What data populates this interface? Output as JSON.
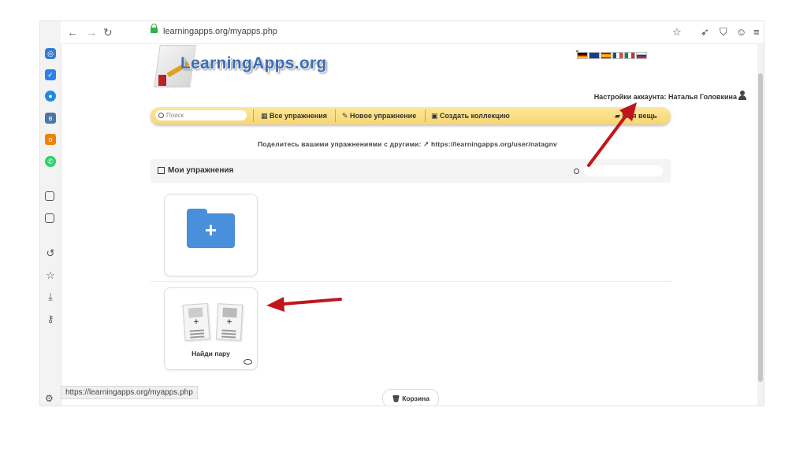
{
  "browser": {
    "url": "learningapps.org/myapps.php",
    "status_url": "https://learningapps.org/myapps.php"
  },
  "site": {
    "logo_text": "LearningApps.org",
    "account_label": "Настройки аккаунта: Наталья Головкина",
    "search_placeholder": "Поиск",
    "menu": {
      "all": "Все упражнения",
      "new": "Новое упражнение",
      "collection": "Создать коллекцию",
      "mine": "Моя вещь"
    },
    "share_text": "Поделитесь вашими упражнениями с другими:",
    "share_link": "https://learningapps.org/user/natagnv",
    "panel_title": "Мои упражнения",
    "app_card_label": "Найди пару",
    "trash_label": "Корзина"
  },
  "colors": {
    "menu_bar": "#f8d670",
    "folder": "#4a8fdb",
    "arrow": "#c0161b"
  },
  "icons": [
    "instagram-icon",
    "checkbox-icon",
    "messenger-icon",
    "vk-icon",
    "odnoklassniki-icon",
    "whatsapp-icon",
    "player-icon",
    "screenshot-icon",
    "history-icon",
    "star-icon",
    "download-icon",
    "key-icon",
    "settings-icon"
  ]
}
